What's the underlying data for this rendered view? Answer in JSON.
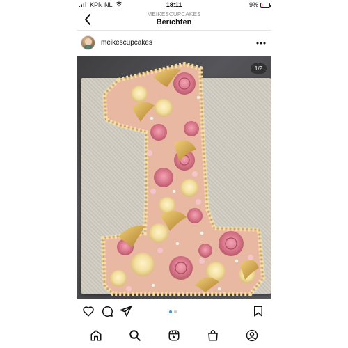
{
  "status_bar": {
    "carrier": "KPN NL",
    "time": "18:11",
    "battery": "9%"
  },
  "header": {
    "subtitle": "MEIKESCUPCAKES",
    "title": "Berichten"
  },
  "post": {
    "username": "meikescupcakes",
    "image_counter": "1/2",
    "carousel": {
      "count": 2,
      "active": 1
    }
  },
  "icons": {
    "back": "chevron-left-icon",
    "more": "more-horizontal-icon",
    "like": "heart-icon",
    "comment": "comment-icon",
    "share": "send-icon",
    "save": "bookmark-icon",
    "nav": [
      "home-icon",
      "search-icon",
      "reels-icon",
      "shop-icon",
      "profile-icon"
    ]
  },
  "colors": {
    "accent": "#3897f0",
    "frosting_pink": "#d9768a",
    "frosting_cream": "#f3dfa0",
    "gold": "#c99a3d"
  }
}
